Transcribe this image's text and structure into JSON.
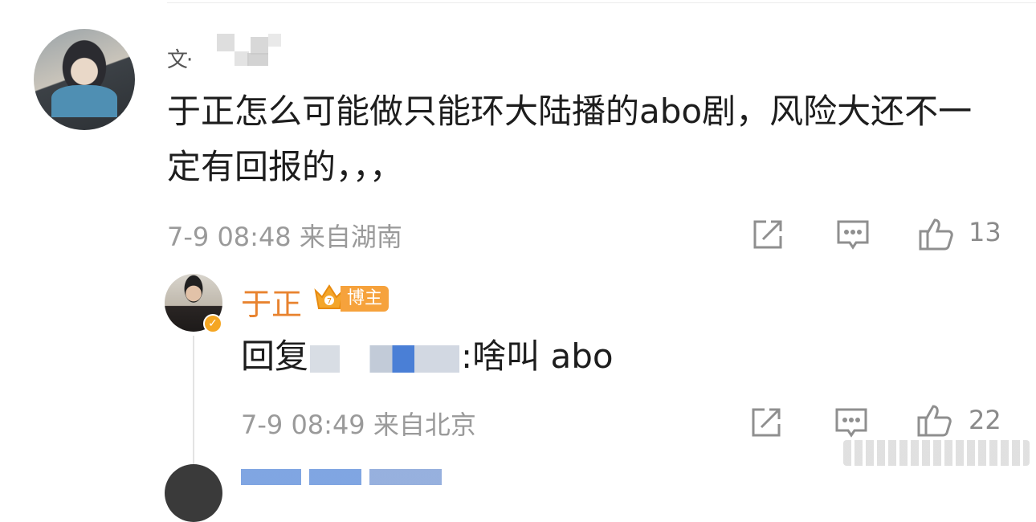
{
  "comment": {
    "text": "于正怎么可能做只能环大陆播的abo剧，风险大还不一定有回报的，，，",
    "timestamp": "7-9 08:48",
    "location": "来自湖南",
    "likes": "13",
    "icons": [
      "share-icon",
      "comment-icon",
      "like-icon"
    ]
  },
  "reply": {
    "author": "于正",
    "badge": "博主",
    "prefix": "回复",
    "message": ":啥叫 abo",
    "timestamp": "7-9 08:49",
    "location": "来自北京",
    "likes": "22",
    "colors": {
      "author": "#e8832f",
      "badge": "#f6a23c"
    }
  }
}
